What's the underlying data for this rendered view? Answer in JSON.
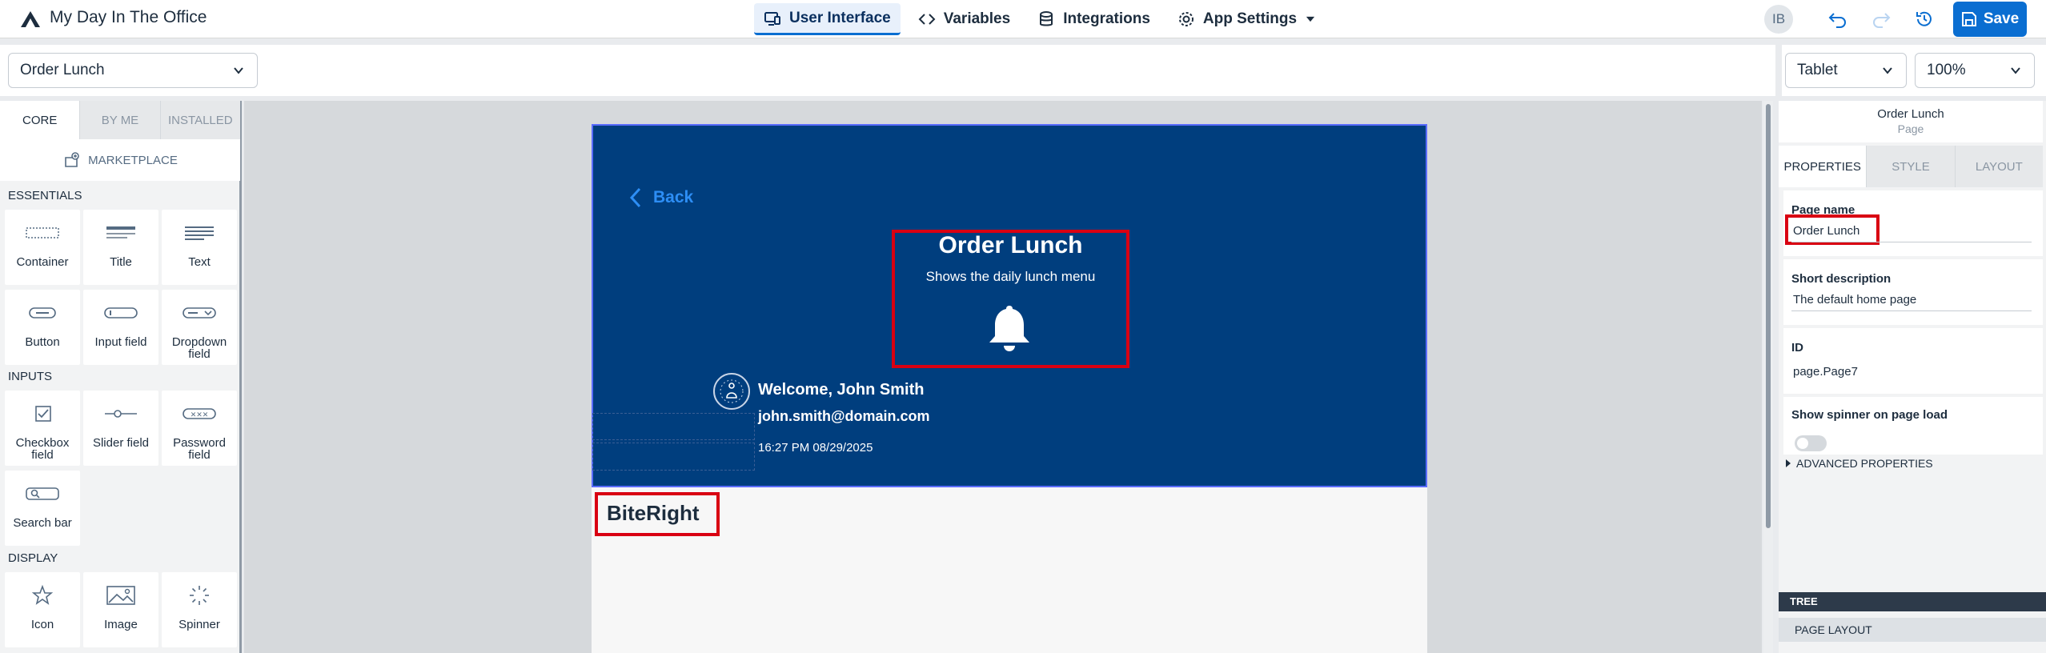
{
  "app": {
    "title": "My Day In The Office",
    "avatar_initials": "IB",
    "save_label": "Save"
  },
  "nav": [
    {
      "label": "User Interface",
      "icon": "monitor-icon",
      "active": true
    },
    {
      "label": "Variables",
      "icon": "code-icon",
      "active": false
    },
    {
      "label": "Integrations",
      "icon": "database-icon",
      "active": false
    },
    {
      "label": "App Settings",
      "icon": "gear-icon",
      "active": false
    }
  ],
  "toolbar": {
    "page_select": "Order Lunch",
    "device_select": "Tablet",
    "zoom_select": "100%"
  },
  "left_panel": {
    "tabs": [
      "CORE",
      "BY ME",
      "INSTALLED"
    ],
    "marketplace": "MARKETPLACE",
    "sections": {
      "essentials": "ESSENTIALS",
      "inputs": "INPUTS",
      "display": "DISPLAY"
    },
    "components": {
      "container": "Container",
      "title": "Title",
      "text": "Text",
      "button": "Button",
      "input_field": "Input field",
      "dropdown_field": "Dropdown field",
      "checkbox_field": "Checkbox field",
      "slider_field": "Slider field",
      "password_field": "Password field",
      "search_bar": "Search bar",
      "icon": "Icon",
      "image": "Image",
      "spinner": "Spinner"
    }
  },
  "canvas": {
    "back_label": "Back",
    "hero_title": "Order Lunch",
    "hero_subtitle": "Shows the daily lunch menu",
    "welcome": "Welcome, John Smith",
    "email": "john.smith@domain.com",
    "datetime": "16:27 PM 08/29/2025",
    "biteright": "BiteRight",
    "colors": {
      "header_bg": "#003e7e",
      "highlight": "#d90012",
      "accent": "#0a6ed1"
    }
  },
  "right_panel": {
    "title": "Order Lunch",
    "subtitle": "Page",
    "tabs": [
      "PROPERTIES",
      "STYLE",
      "LAYOUT"
    ],
    "page_name_label": "Page name",
    "page_name_value": "Order Lunch",
    "short_desc_label": "Short description",
    "short_desc_value": "The default home page",
    "id_label": "ID",
    "id_value": "page.Page7",
    "spinner_label": "Show spinner on page load",
    "advanced": "ADVANCED PROPERTIES",
    "tree": "TREE",
    "page_layout": "PAGE LAYOUT"
  }
}
